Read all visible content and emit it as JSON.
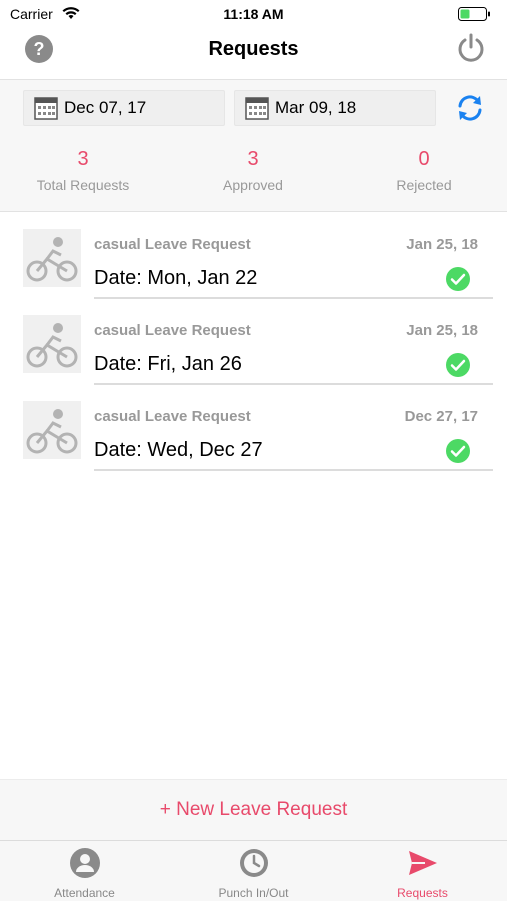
{
  "status_bar": {
    "carrier": "Carrier",
    "time": "11:18 AM"
  },
  "nav": {
    "title": "Requests"
  },
  "date_range": {
    "from": "Dec 07, 17",
    "to": "Mar 09, 18"
  },
  "summary": [
    {
      "count": "3",
      "label": "Total Requests"
    },
    {
      "count": "3",
      "label": "Approved"
    },
    {
      "count": "0",
      "label": "Rejected"
    }
  ],
  "requests": [
    {
      "type": "casual Leave Request",
      "request_date": "Jan 25, 18",
      "leave_date": "Date: Mon, Jan 22",
      "status": "approved"
    },
    {
      "type": "casual Leave Request",
      "request_date": "Jan 25, 18",
      "leave_date": "Date: Fri, Jan 26",
      "status": "approved"
    },
    {
      "type": "casual Leave Request",
      "request_date": "Dec 27, 17",
      "leave_date": "Date: Wed, Dec 27",
      "status": "approved"
    }
  ],
  "new_leave_label": "+ New Leave Request",
  "tabs": [
    {
      "label": "Attendance",
      "icon": "person-icon"
    },
    {
      "label": "Punch In/Out",
      "icon": "clock-icon"
    },
    {
      "label": "Requests",
      "icon": "paper-plane-icon",
      "active": true
    }
  ],
  "colors": {
    "accent": "#e84a6b",
    "approved": "#4cd964",
    "refresh": "#1a82f0"
  }
}
